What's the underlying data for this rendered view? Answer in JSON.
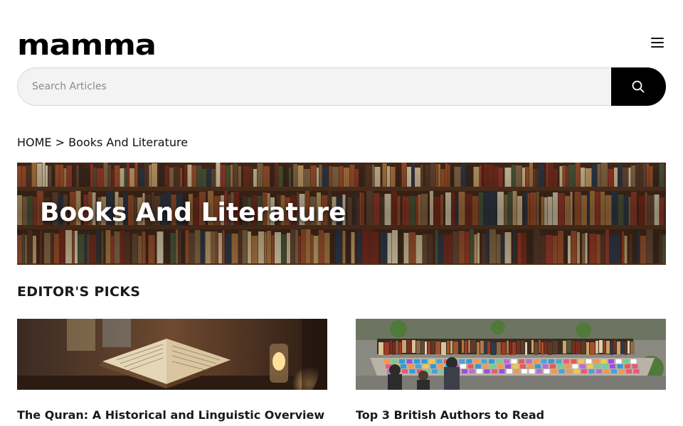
{
  "header": {
    "logo": "mamma",
    "menu_icon": "hamburger-icon"
  },
  "search": {
    "placeholder": "Search Articles",
    "button_icon": "search-icon"
  },
  "breadcrumb": {
    "home": "HOME",
    "separator": ">",
    "current": "Books And Literature"
  },
  "hero": {
    "title": "Books And Literature"
  },
  "editors_picks": {
    "heading": "EDITOR'S PICKS",
    "articles": [
      {
        "title": "The Quran: A Historical and Linguistic Overview"
      },
      {
        "title": "Top 3 British Authors to Read"
      }
    ]
  },
  "colors": {
    "accent": "#000000",
    "search_bg": "#f3f3f4"
  }
}
